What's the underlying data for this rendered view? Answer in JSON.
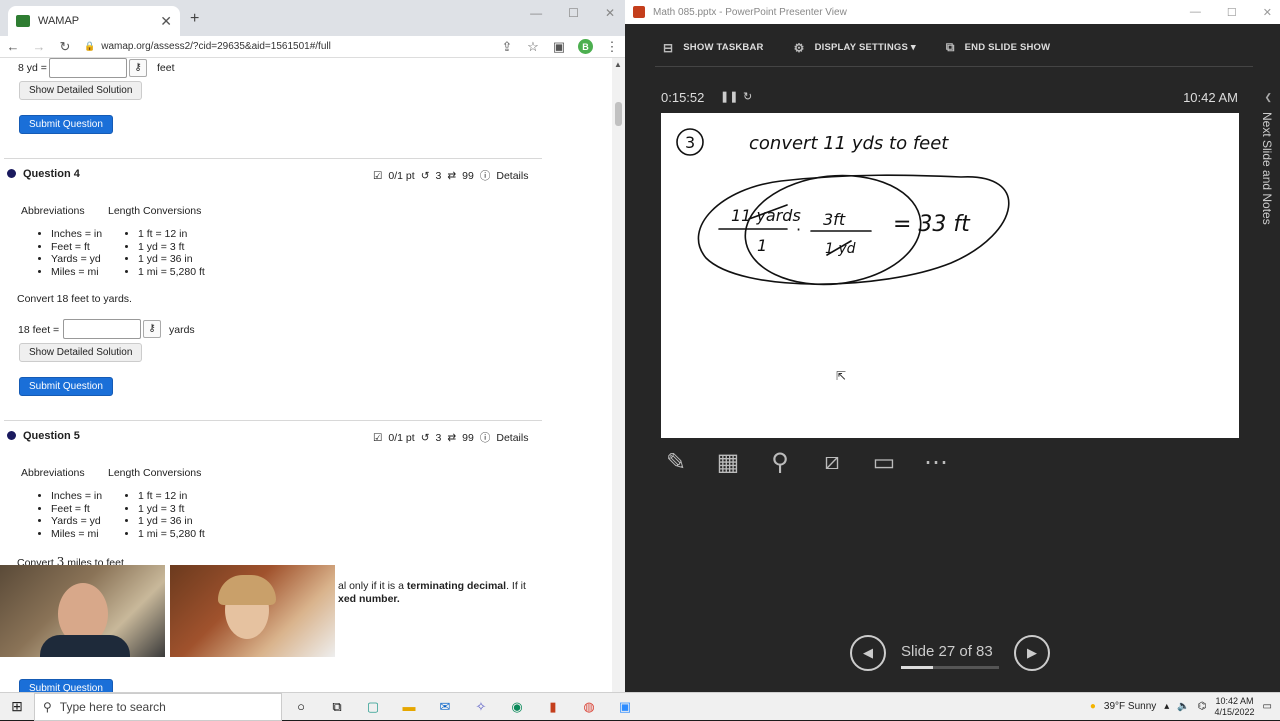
{
  "browser": {
    "tab_title": "WAMAP",
    "url": "wamap.org/assess2/?cid=29635&aid=1561501#/full",
    "profile_initial": "B"
  },
  "question3_tail": {
    "prefix": "8 yd =",
    "unit": "feet",
    "detail_label": "Show Detailed Solution",
    "submit_label": "Submit Question"
  },
  "question4": {
    "title": "Question 4",
    "score": "0/1 pt",
    "tries": "3",
    "versions": "99",
    "details": "Details",
    "abbrev_heading": "Abbreviations",
    "conv_heading": "Length Conversions",
    "abbrevs": [
      "Inches = in",
      "Feet = ft",
      "Yards = yd",
      "Miles = mi"
    ],
    "convs": [
      "1 ft = 12 in",
      "1 yd = 3 ft",
      "1 yd = 36 in",
      "1 mi = 5,280 ft"
    ],
    "prompt": "Convert 18 feet to yards.",
    "input_prefix": "18 feet =",
    "unit": "yards",
    "detail_label": "Show Detailed Solution",
    "submit_label": "Submit Question"
  },
  "question5": {
    "title": "Question 5",
    "score": "0/1 pt",
    "tries": "3",
    "versions": "99",
    "details": "Details",
    "abbrev_heading": "Abbreviations",
    "conv_heading": "Length Conversions",
    "abbrevs": [
      "Inches = in",
      "Feet = ft",
      "Yards = yd",
      "Miles = mi"
    ],
    "convs": [
      "1 ft = 12 in",
      "1 yd = 3 ft",
      "1 yd = 36 in",
      "1 mi = 5,280 ft"
    ],
    "prompt_a": "Convert",
    "prompt_num": "3",
    "prompt_b": "miles to feet",
    "instr_line1_a": "al only if it is a ",
    "instr_line1_bold": "terminating decimal",
    "instr_line1_b": ". If it",
    "instr_line2_bold": "xed number.",
    "submit_label": "Submit Question"
  },
  "ppt": {
    "window_title": "Math 085.pptx - PowerPoint Presenter View",
    "show_taskbar": "SHOW TASKBAR",
    "display_settings": "DISPLAY SETTINGS ▾",
    "end_show": "END SLIDE SHOW",
    "timer": "0:15:52",
    "clock": "10:42 AM",
    "side_label": "Next Slide and Notes",
    "slide_status": "Slide 27 of 83",
    "slide_progress": 0.325
  },
  "slide_ink": {
    "number": "3",
    "heading": "convert 11 yds to feet",
    "num1": "11 yards",
    "den1": "1",
    "num2": "3ft",
    "den2": "1 yd",
    "result": "= 33 ft"
  },
  "taskbar": {
    "search_placeholder": "Type here to search",
    "weather": "39°F  Sunny",
    "time": "10:42 AM",
    "date": "4/15/2022"
  }
}
